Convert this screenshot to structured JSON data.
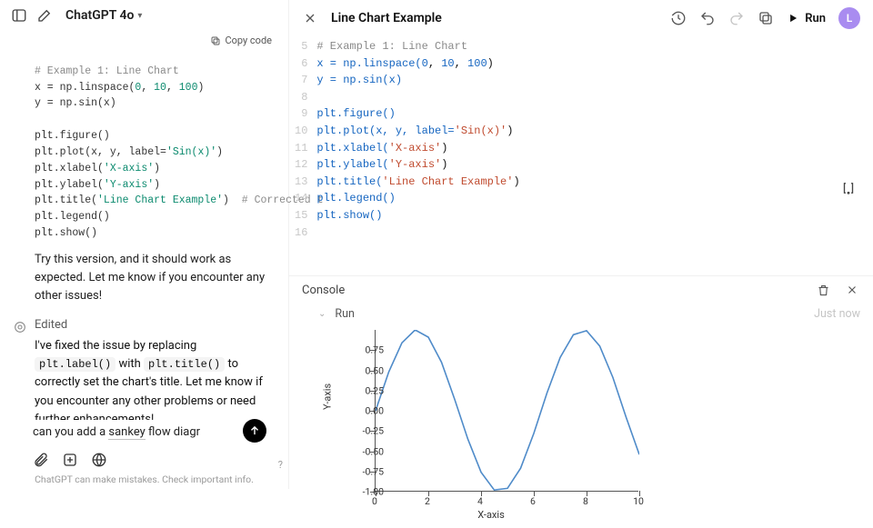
{
  "left": {
    "model": "ChatGPT 4o",
    "copy_label": "Copy code",
    "code": {
      "l1": "# Example 1: Line Chart",
      "l2a": "x = np.linspace(",
      "l2b": "0",
      "l2c": ", ",
      "l2d": "10",
      "l2e": ", ",
      "l2f": "100",
      "l2g": ")",
      "l3": "y = np.sin(x)",
      "l5": "plt.figure()",
      "l6a": "plt.plot(x, y, label=",
      "l6b": "'Sin(x)'",
      "l6c": ")",
      "l7a": "plt.xlabel(",
      "l7b": "'X-axis'",
      "l7c": ")",
      "l8a": "plt.ylabel(",
      "l8b": "'Y-axis'",
      "l8c": ")",
      "l9a": "plt.title(",
      "l9b": "'Line Chart Example'",
      "l9c": ")  ",
      "l9d": "# Corrected t",
      "l10": "plt.legend()",
      "l11": "plt.show()"
    },
    "msg1": "Try this version, and it should work as expected. Let me know if you encounter any other issues!",
    "edited_label": "Edited",
    "msg2_a": "I've fixed the issue by replacing ",
    "msg2_code1": "plt.label()",
    "msg2_b": " with ",
    "msg2_code2": "plt.title()",
    "msg2_c": " to correctly set the chart's title. Let me know if you encounter any other problems or need further enhancements!",
    "composer_pre": "can you add a ",
    "composer_ul": "sankey",
    "composer_post": " flow diagr",
    "disclaimer": "ChatGPT can make mistakes. Check important info.",
    "qmark": "?"
  },
  "right": {
    "title": "Line Chart Example",
    "run_label": "Run",
    "avatar": "L",
    "code_lines": [
      {
        "n": "5",
        "pre": "",
        "comment": "# Example 1: Line Chart"
      },
      {
        "n": "6",
        "pre": "x = np.linspace(",
        "nums": [
          "0",
          "10",
          "100"
        ],
        "post": ")"
      },
      {
        "n": "7",
        "pre": "y = np.sin(x)"
      },
      {
        "n": "8",
        "pre": ""
      },
      {
        "n": "9",
        "pre": "plt.figure()"
      },
      {
        "n": "10",
        "pre": "plt.plot(x, y, label=",
        "str": "'Sin(x)'",
        "post": ")"
      },
      {
        "n": "11",
        "pre": "plt.xlabel(",
        "str": "'X-axis'",
        "post": ")"
      },
      {
        "n": "12",
        "pre": "plt.ylabel(",
        "str": "'Y-axis'",
        "post": ")"
      },
      {
        "n": "13",
        "pre": "plt.title(",
        "str": "'Line Chart Example'",
        "post": ")"
      },
      {
        "n": "14",
        "pre": "plt.legend()"
      },
      {
        "n": "15",
        "pre": "plt.show()"
      },
      {
        "n": "16",
        "pre": ""
      }
    ],
    "console_label": "Console",
    "run_entry": "Run",
    "run_time": "Just now"
  },
  "chart_data": {
    "type": "line",
    "title": "",
    "xlabel": "X-axis",
    "ylabel": "Y-axis",
    "xlim": [
      0,
      10
    ],
    "ylim": [
      -1.0,
      1.0
    ],
    "x_ticks": [
      0,
      2,
      4,
      6,
      8,
      10
    ],
    "y_ticks": [
      -1.0,
      -0.75,
      -0.5,
      -0.25,
      0.0,
      0.25,
      0.5,
      0.75
    ],
    "series": [
      {
        "name": "Sin(x)",
        "x": [
          0,
          0.5,
          1,
          1.5,
          2,
          2.5,
          3,
          3.5,
          4,
          4.5,
          5,
          5.5,
          6,
          6.5,
          7,
          7.5,
          8,
          8.5,
          9,
          9.5,
          10
        ],
        "y": [
          0.0,
          0.48,
          0.84,
          1.0,
          0.91,
          0.6,
          0.14,
          -0.35,
          -0.76,
          -0.98,
          -0.96,
          -0.71,
          -0.28,
          0.22,
          0.66,
          0.94,
          0.99,
          0.8,
          0.41,
          -0.08,
          -0.54
        ]
      }
    ]
  }
}
